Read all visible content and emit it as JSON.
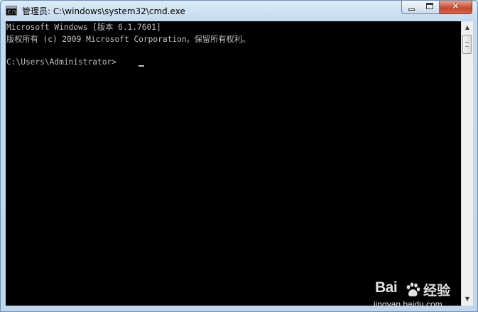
{
  "window": {
    "title": "管理员: C:\\windows\\system32\\cmd.exe",
    "icon": "cmd-console-icon",
    "icon_text": "C:\\",
    "controls": {
      "minimize": "minimize-icon",
      "maximize": "maximize-icon",
      "close_glyph": "✕"
    }
  },
  "console": {
    "lines": [
      "Microsoft Windows [版本 6.1.7601]",
      "版权所有 (c) 2009 Microsoft Corporation。保留所有权利。",
      "",
      "C:\\Users\\Administrator>"
    ],
    "foreground": "#c0c0c0",
    "background": "#000000"
  },
  "scrollbar": {
    "up_glyph": "▲",
    "down_glyph": "▼"
  },
  "watermark": {
    "brand": "Bai",
    "product": "经验",
    "url": "jingyan.baidu.com"
  }
}
